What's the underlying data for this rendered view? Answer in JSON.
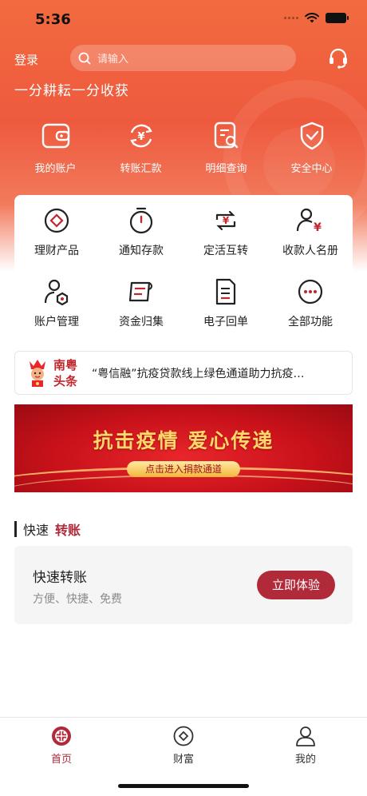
{
  "status_bar": {
    "time": "5:36"
  },
  "header": {
    "login_label": "登录",
    "search_placeholder": "请输入",
    "slogan": "一分耕耘一分收获"
  },
  "quick_actions": [
    {
      "label": "我的账户",
      "icon": "wallet-icon"
    },
    {
      "label": "转账汇款",
      "icon": "yuan-transfer-icon"
    },
    {
      "label": "明细查询",
      "icon": "document-search-icon"
    },
    {
      "label": "安全中心",
      "icon": "shield-check-icon"
    }
  ],
  "functions": [
    {
      "label": "理财产品",
      "icon": "diamond-coin-icon"
    },
    {
      "label": "通知存款",
      "icon": "stopwatch-icon"
    },
    {
      "label": "定活互转",
      "icon": "yuan-exchange-icon"
    },
    {
      "label": "收款人名册",
      "icon": "payee-icon"
    },
    {
      "label": "账户管理",
      "icon": "user-settings-icon"
    },
    {
      "label": "资金归集",
      "icon": "fund-collect-icon"
    },
    {
      "label": "电子回单",
      "icon": "receipt-icon"
    },
    {
      "label": "全部功能",
      "icon": "more-icon"
    }
  ],
  "news": {
    "brand_line1": "南粤",
    "brand_line2": "头条",
    "headline": "“粤信融”抗疫贷款线上绿色通道助力抗疫…"
  },
  "banner": {
    "title": "抗击疫情  爱心传递",
    "button": "点击进入捐款通道"
  },
  "section": {
    "title_a": "快速",
    "title_b": "转账"
  },
  "transfer_card": {
    "title": "快速转账",
    "subtitle": "方便、快捷、免费",
    "button": "立即体验"
  },
  "tabs": [
    {
      "label": "首页",
      "icon": "home-icon",
      "active": true
    },
    {
      "label": "财富",
      "icon": "wealth-icon",
      "active": false
    },
    {
      "label": "我的",
      "icon": "user-icon",
      "active": false
    }
  ],
  "colors": {
    "accent": "#b12a3a",
    "header": "#ee5a3e",
    "banner_gold": "#ffd76a"
  }
}
